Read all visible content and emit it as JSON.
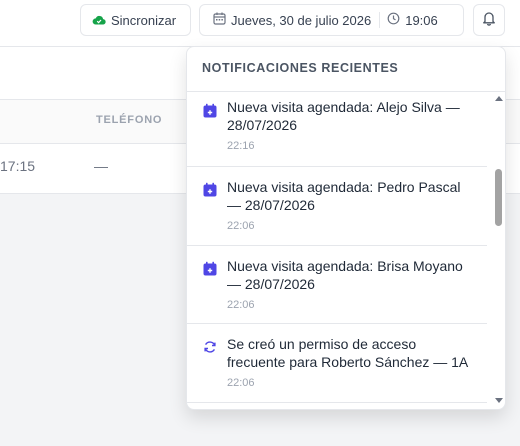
{
  "header": {
    "sync_label": "Sincronizar",
    "date_label": "Jueves, 30 de julio 2026",
    "time_label": "19:06"
  },
  "table": {
    "col_telefono": "TELÉFONO",
    "row_time_fragment": "17:15",
    "row_telefono": "—"
  },
  "notifications": {
    "title": "NOTIFICACIONES RECIENTES",
    "items": [
      {
        "icon": "calendar-plus-icon",
        "text": "Nueva visita agendada: Alejo Silva — 28/07/2026",
        "time": "22:16"
      },
      {
        "icon": "calendar-plus-icon",
        "text": "Nueva visita agendada: Pedro Pascal — 28/07/2026",
        "time": "22:06"
      },
      {
        "icon": "calendar-plus-icon",
        "text": "Nueva visita agendada: Brisa Moyano — 28/07/2026",
        "time": "22:06"
      },
      {
        "icon": "refresh-icon",
        "text": "Se creó un permiso de acceso frecuente para Roberto Sánchez — 1A",
        "time": "22:06"
      }
    ]
  },
  "colors": {
    "accent_indigo": "#4f46e5",
    "sync_cloud_green": "#16a34a"
  }
}
